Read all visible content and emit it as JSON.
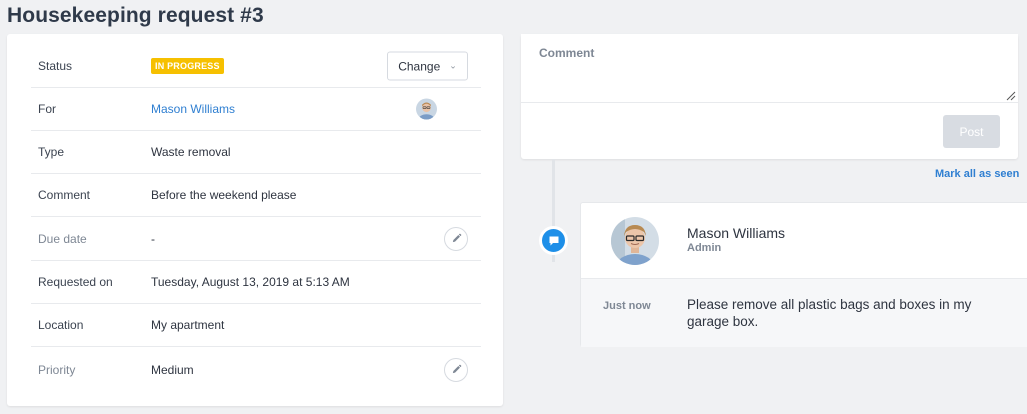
{
  "page": {
    "title": "Housekeeping request #3"
  },
  "details": {
    "status": {
      "label": "Status",
      "value": "IN PROGRESS",
      "change_label": "Change",
      "badge_color": "#f6c000"
    },
    "for": {
      "label": "For",
      "value": "Mason Williams"
    },
    "type": {
      "label": "Type",
      "value": "Waste removal"
    },
    "comment": {
      "label": "Comment",
      "value": "Before the weekend please"
    },
    "due_date": {
      "label": "Due date",
      "value": "-"
    },
    "requested_on": {
      "label": "Requested on",
      "value": "Tuesday, August 13, 2019 at 5:13 AM"
    },
    "location": {
      "label": "Location",
      "value": "My apartment"
    },
    "priority": {
      "label": "Priority",
      "value": "Medium"
    }
  },
  "comment_form": {
    "placeholder": "Comment",
    "post_label": "Post"
  },
  "timeline": {
    "mark_all_seen": "Mark all as seen",
    "entries": [
      {
        "author": "Mason Williams",
        "role": "Admin",
        "time": "Just now",
        "text": "Please remove all plastic bags and boxes in my garage box."
      }
    ]
  },
  "colors": {
    "accent": "#1e8fe8",
    "link": "#2f7fd1"
  }
}
